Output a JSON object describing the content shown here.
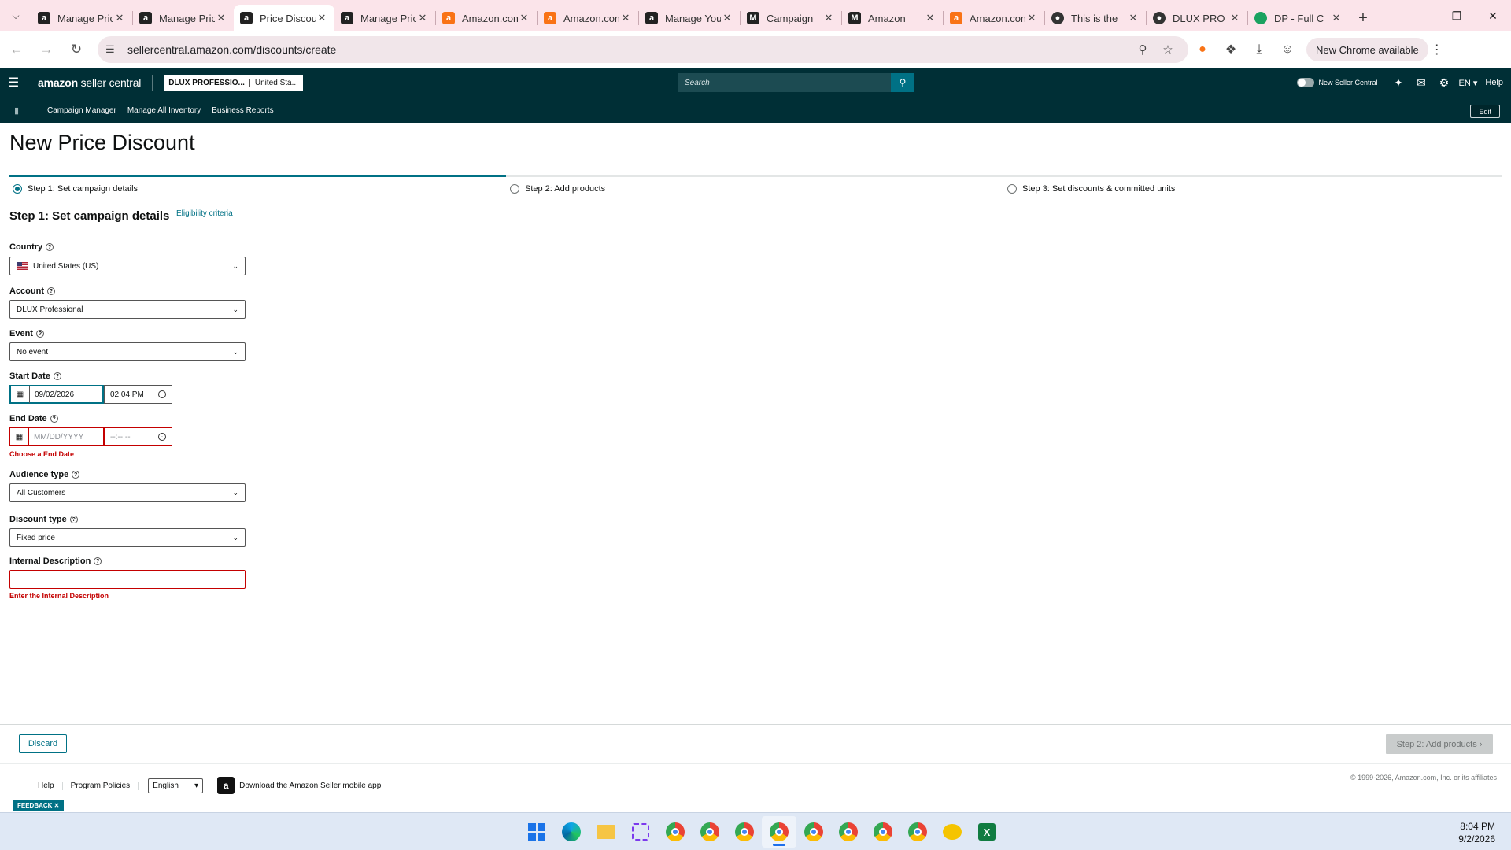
{
  "browser": {
    "tabs": [
      {
        "title": "Manage Pricing",
        "icon": "amazon-icon",
        "active": false
      },
      {
        "title": "Manage Pricing",
        "icon": "amazon-icon",
        "active": false
      },
      {
        "title": "Price Discounts",
        "icon": "amazon-icon",
        "active": true
      },
      {
        "title": "Manage Pricing",
        "icon": "amazon-icon",
        "active": false
      },
      {
        "title": "Amazon.com",
        "icon": "amazon-orange-icon",
        "active": false
      },
      {
        "title": "Amazon.com",
        "icon": "amazon-orange-icon",
        "active": false
      },
      {
        "title": "Manage Your",
        "icon": "amazon-icon",
        "active": false
      },
      {
        "title": "Campaign",
        "icon": "gmail-icon",
        "active": false
      },
      {
        "title": "Amazon",
        "icon": "gmail-icon",
        "active": false
      },
      {
        "title": "Amazon.com",
        "icon": "amazon-orange-icon",
        "active": false
      },
      {
        "title": "This is the",
        "icon": "github-icon",
        "active": false
      },
      {
        "title": "DLUX PRO",
        "icon": "github-icon",
        "active": false
      },
      {
        "title": "DP - Full C",
        "icon": "green-dot-icon",
        "active": false
      }
    ],
    "url": "sellercentral.amazon.com/discounts/create",
    "new_chrome_label": "New Chrome available"
  },
  "header": {
    "logo_bold": "amazon",
    "logo_thin": " seller central",
    "account_name": "DLUX PROFESSIO...",
    "marketplace": "United Sta...",
    "search_placeholder": "Search",
    "new_seller_central": "New Seller Central",
    "language": "EN ▾",
    "help": "Help"
  },
  "subnav": {
    "links": [
      "Campaign Manager",
      "Manage All Inventory",
      "Business Reports"
    ],
    "edit_label": "Edit"
  },
  "page": {
    "title": "New Price Discount",
    "progress_fraction": 0.333,
    "steps": [
      {
        "label": "Step 1: Set campaign details",
        "selected": true
      },
      {
        "label": "Step 2: Add products",
        "selected": false
      },
      {
        "label": "Step 3: Set discounts & committed units",
        "selected": false
      }
    ],
    "section_title": "Step 1: Set campaign details",
    "eligibility_link": "Eligibility criteria"
  },
  "form": {
    "country": {
      "label": "Country",
      "value": "United States (US)"
    },
    "account": {
      "label": "Account",
      "value": "DLUX Professional"
    },
    "event": {
      "label": "Event",
      "value": "No event"
    },
    "start_date": {
      "label": "Start Date",
      "date": "09/02/2026",
      "time": "02:04 PM"
    },
    "end_date": {
      "label": "End Date",
      "date_placeholder": "MM/DD/YYYY",
      "time_placeholder": "--:-- --",
      "error": "Choose a End Date"
    },
    "audience": {
      "label": "Audience type",
      "value": "All Customers"
    },
    "discount_type": {
      "label": "Discount type",
      "value": "Fixed price"
    },
    "internal_description": {
      "label": "Internal Description",
      "value": "",
      "error": "Enter the Internal Description"
    }
  },
  "actions": {
    "discard": "Discard",
    "next": "Step 2: Add products"
  },
  "footer": {
    "links": [
      "Help",
      "Program Policies"
    ],
    "language": "English",
    "app_download": "Download the Amazon Seller mobile app",
    "copyright": "© 1999-2026, Amazon.com, Inc. or its affiliates",
    "feedback": "FEEDBACK ✕"
  },
  "taskbar": {
    "time": "8:04 PM",
    "date": "9/2/2026"
  },
  "colors": {
    "brand_dark": "#002f36",
    "accent_teal": "#007185",
    "error_red": "#c40000",
    "tabstrip_pink": "#fbe4ea"
  }
}
